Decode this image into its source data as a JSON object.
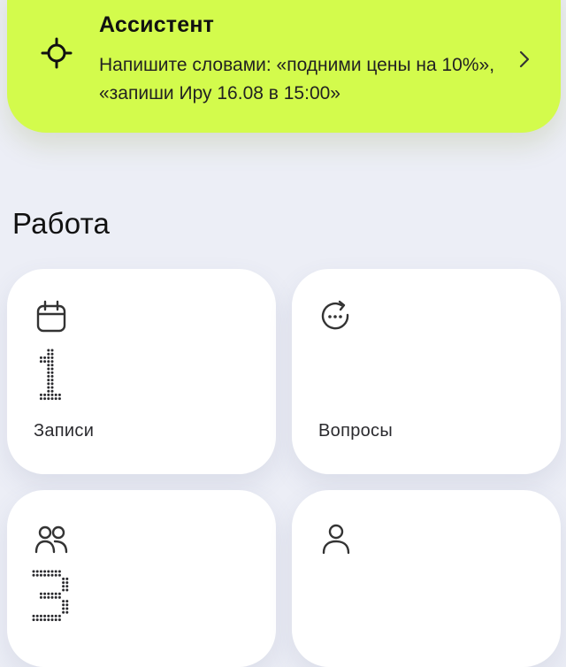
{
  "assistant": {
    "title": "Ассистент",
    "description": "Напишите словами: «подними цены на 10%», «запиши Иру 16.08 в 15:00»",
    "icon": "target-icon",
    "chevron": "chevron-right-icon",
    "background": "#d3fb4c"
  },
  "section": {
    "title": "Работа"
  },
  "cards": [
    {
      "icon": "calendar-icon",
      "count": "1",
      "label": "Записи"
    },
    {
      "icon": "chat-refresh-icon",
      "count": "",
      "label": "Вопросы"
    },
    {
      "icon": "users-icon",
      "count": "3",
      "label": ""
    },
    {
      "icon": "user-icon",
      "count": "",
      "label": ""
    }
  ]
}
